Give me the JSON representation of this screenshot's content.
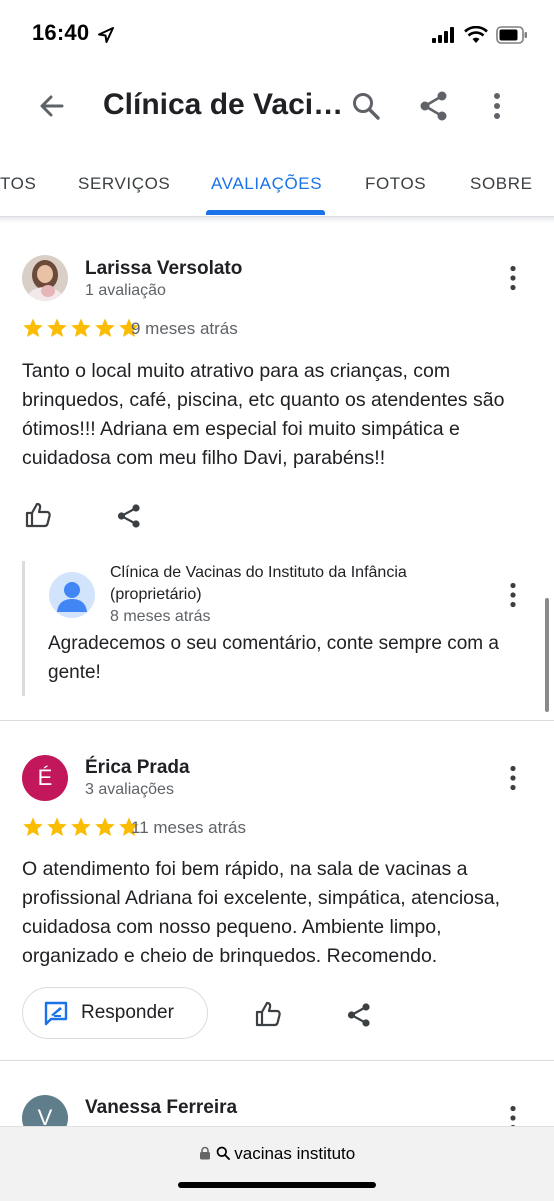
{
  "status": {
    "time": "16:40"
  },
  "appbar": {
    "title": "Clínica de Vaci…"
  },
  "tabs": [
    "TOS",
    "SERVIÇOS",
    "AVALIAÇÕES",
    "FOTOS",
    "SOBRE"
  ],
  "reviews": [
    {
      "name": "Larissa Versolato",
      "count": "1 avaliação",
      "rating": 5,
      "time": "9 meses atrás",
      "text": "Tanto o local muito atrativo para as crianças, com brinquedos, café, piscina, etc quanto os atendentes são ótimos!!! Adriana em especial foi muito simpática e cuidadosa com meu filho Davi, parabéns!!",
      "owner_reply": {
        "name": "Clínica de Vacinas do Instituto da Infância (proprietário)",
        "time": "8 meses atrás",
        "text": "Agradecemos o seu comentário, conte sempre com a gente!"
      }
    },
    {
      "name": "Érica Prada",
      "initial": "É",
      "avatar_color": "#c2185b",
      "count": "3 avaliações",
      "rating": 5,
      "time": "11 meses atrás",
      "text": "O atendimento foi bem rápido, na sala de vacinas a profissional Adriana foi excelente, simpática, atenciosa, cuidadosa com nosso pequeno. Ambiente limpo, organizado e cheio de brinquedos. Recomendo.",
      "respond_label": "Responder"
    },
    {
      "name": "Vanessa Ferreira",
      "initial": "V",
      "avatar_color": "#607d8b"
    }
  ],
  "browser": {
    "url": "vacinas instituto"
  },
  "colors": {
    "accent": "#1a73e8",
    "star": "#fbbc04"
  }
}
